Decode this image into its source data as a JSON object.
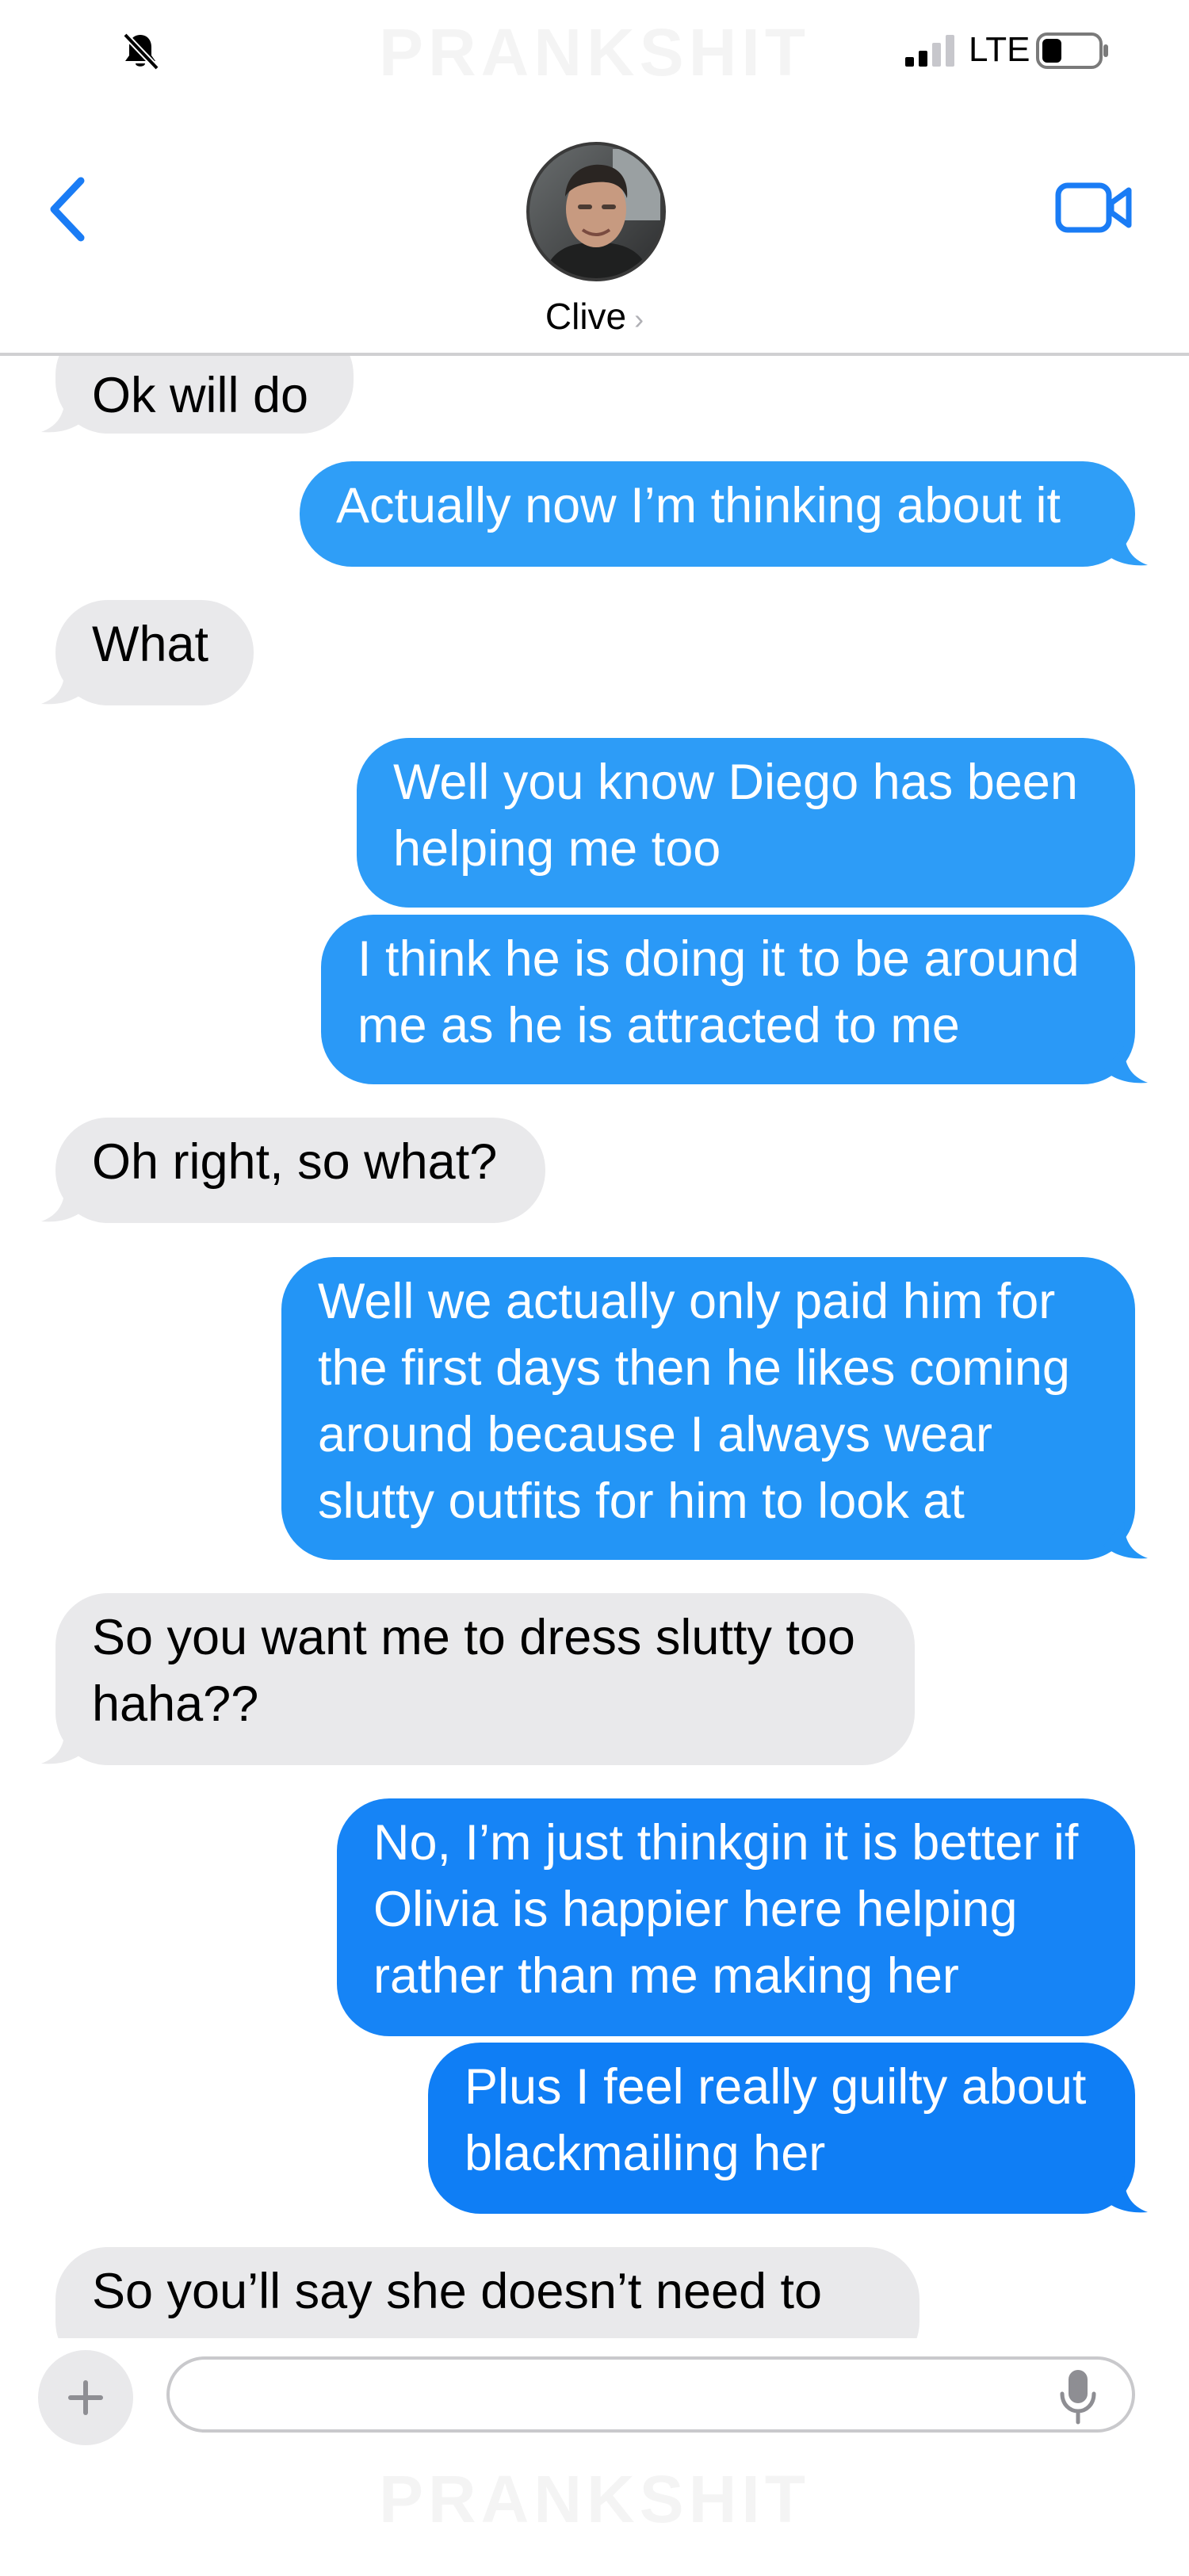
{
  "watermark": "PRANKSHIT",
  "status_bar": {
    "network": "LTE",
    "icons": [
      "bell-slash-icon",
      "signal-icon",
      "battery-icon"
    ]
  },
  "header": {
    "back_icon": "chevron-left-icon",
    "contact_name": "Clive",
    "video_icon": "video-camera-icon"
  },
  "colors": {
    "accent": "#1a7cf5",
    "incoming_bubble": "#e9e9eb",
    "outgoing_gradient_top": "#42a5f7",
    "outgoing_gradient_bottom": "#0a76f5"
  },
  "messages": [
    {
      "direction": "in",
      "lines": [
        "Ok will do"
      ]
    },
    {
      "direction": "out",
      "lines": [
        "Actually now I’m thinking about it"
      ]
    },
    {
      "direction": "in",
      "lines": [
        "What"
      ]
    },
    {
      "direction": "out",
      "lines": [
        "Well you know Diego has been",
        "helping me too"
      ]
    },
    {
      "direction": "out",
      "lines": [
        "I think he is doing it to be around",
        "me as he is attracted to me"
      ]
    },
    {
      "direction": "in",
      "lines": [
        "Oh right, so what?"
      ]
    },
    {
      "direction": "out",
      "lines": [
        "Well we actually only paid him for",
        "the first days then he likes coming",
        "around because I always wear",
        "slutty outfits for him to look at"
      ]
    },
    {
      "direction": "in",
      "lines": [
        "So you want me to dress slutty too",
        "haha??"
      ]
    },
    {
      "direction": "out",
      "lines": [
        "No, I’m just thinkgin it is better if",
        "Olivia is happier here helping",
        "rather than me making her"
      ]
    },
    {
      "direction": "out",
      "lines": [
        "Plus I feel really guilty about",
        "blackmailing her"
      ]
    },
    {
      "direction": "in",
      "lines": [
        "So you’ll say she doesn’t need to"
      ]
    }
  ],
  "input_bar": {
    "plus_icon": "plus-icon",
    "field_value": "",
    "mic_icon": "microphone-icon"
  }
}
